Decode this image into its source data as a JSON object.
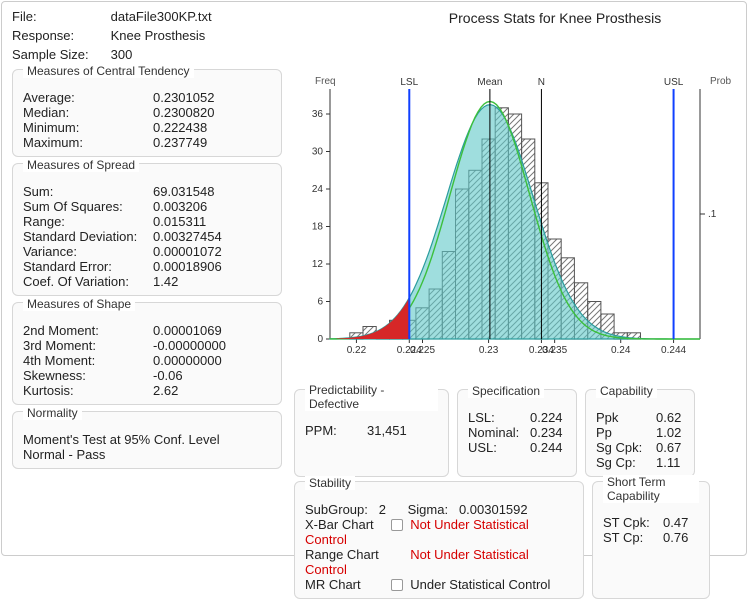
{
  "header": {
    "file_lbl": "File:",
    "file_val": "dataFile300KP.txt",
    "response_lbl": "Response:",
    "response_val": "Knee Prosthesis",
    "sample_lbl": "Sample Size:",
    "sample_val": "300",
    "chart_title": "Process Stats for Knee Prosthesis"
  },
  "central": {
    "title": "Measures of Central Tendency",
    "avg_k": "Average:",
    "avg_v": "0.2301052",
    "med_k": "Median:",
    "med_v": "0.2300820",
    "min_k": "Minimum:",
    "min_v": "0.222438",
    "max_k": "Maximum:",
    "max_v": "0.237749"
  },
  "spread": {
    "title": "Measures of Spread",
    "sum_k": "Sum:",
    "sum_v": "69.031548",
    "ss_k": "Sum Of Squares:",
    "ss_v": "0.003206",
    "rng_k": "Range:",
    "rng_v": "0.015311",
    "sd_k": "Standard Deviation:",
    "sd_v": "0.00327454",
    "var_k": "Variance:",
    "var_v": "0.00001072",
    "se_k": "Standard Error:",
    "se_v": "0.00018906",
    "cov_k": "Coef. Of Variation:",
    "cov_v": "1.42"
  },
  "shape": {
    "title": "Measures of Shape",
    "m2_k": "2nd Moment:",
    "m2_v": "0.00001069",
    "m3_k": "3rd Moment:",
    "m3_v": "-0.00000000",
    "m4_k": "4th Moment:",
    "m4_v": "0.00000000",
    "sk_k": "Skewness:",
    "sk_v": "-0.06",
    "ku_k": "Kurtosis:",
    "ku_v": "2.62"
  },
  "normality": {
    "title": "Normality",
    "line1": "Moment's Test at 95% Conf. Level",
    "line2": "Normal - Pass"
  },
  "chart_axes": {
    "y_left": "Freq",
    "y_right": "Prob",
    "lsl": "LSL",
    "mean": "Mean",
    "n": "N",
    "usl": "USL",
    "yticks": [
      "0",
      "6",
      "12",
      "18",
      "24",
      "30",
      "36"
    ],
    "xticks": [
      "0.22",
      "0.224",
      "0.225",
      "0.23",
      "0.234",
      "0.235",
      "0.24",
      "0.244"
    ],
    "right_tick": ".1"
  },
  "pred": {
    "title": "Predictability - Defective",
    "ppm_k": "PPM:",
    "ppm_v": "31,451"
  },
  "spec": {
    "title": "Specification",
    "lsl_k": "LSL:",
    "lsl_v": "0.224",
    "nom_k": "Nominal:",
    "nom_v": "0.234",
    "usl_k": "USL:",
    "usl_v": "0.244"
  },
  "cap": {
    "title": "Capability",
    "ppk_k": "Ppk",
    "ppk_v": "0.62",
    "pp_k": "Pp",
    "pp_v": "1.02",
    "sgcpk_k": "Sg Cpk:",
    "sgcpk_v": "0.67",
    "sgcp_k": "Sg Cp:",
    "sgcp_v": "1.11"
  },
  "stab": {
    "title": "Stability",
    "sub_k": "SubGroup:",
    "sub_v": "2",
    "sig_k": "Sigma:",
    "sig_v": "0.00301592",
    "xbar_k": "X-Bar Chart",
    "xbar_v": "Not Under Statistical Control",
    "rng_k": "Range Chart",
    "rng_v": "Not Under Statistical Control",
    "mr_k": "MR Chart",
    "mr_v": "Under Statistical Control"
  },
  "stc": {
    "title": "Short Term Capability",
    "cpk_k": "ST Cpk:",
    "cpk_v": "0.47",
    "cp_k": "ST Cp:",
    "cp_v": "0.76"
  },
  "chart_data": {
    "type": "histogram+density",
    "x_range": [
      0.218,
      0.246
    ],
    "y_range": [
      0,
      40
    ],
    "vlines": {
      "LSL": 0.224,
      "Mean": 0.2301,
      "N": 0.234,
      "USL": 0.244
    },
    "histogram": {
      "bin_start": 0.2195,
      "bin_width": 0.001,
      "counts": [
        1,
        2,
        1,
        3,
        3,
        5,
        8,
        14,
        24,
        27,
        32,
        37,
        36,
        32,
        25,
        16,
        13,
        9,
        6,
        4,
        1,
        1
      ]
    },
    "defective_fill_below_lsl": true,
    "y_right_label": "Prob",
    "y_right_tick": 0.1
  }
}
